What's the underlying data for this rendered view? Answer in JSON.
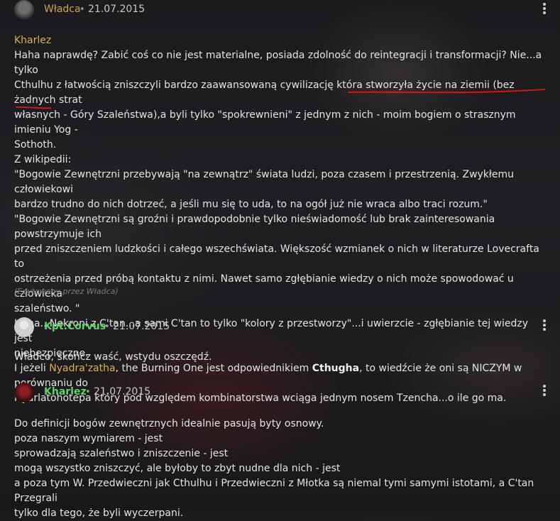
{
  "comments": [
    {
      "author": "Władca",
      "date": "21.07.2015",
      "quote_author": "Kharlez",
      "lines": [
        "Haha naprawdę? Zabić coś co nie jest materialne, posiada zdolność do reintegracji i transformacji? Nie...a tylko",
        "Cthulhu z łatwością zniszczyli bardzo zaawansowaną cywilizację która stworzyła życie na ziemii (bez żadnych strat",
        "własnych - Góry Szaleństwa),a byli tylko \"spokrewnieni\" z jednym z nich - moim bogiem o strasznym imieniu Yog -",
        "Sothoth.",
        "Z wikipedii:",
        "\"Bogowie Zewnętrzni przebywają \"na zewnątrz\" świata ludzi, poza czasem i przestrzenią. Zwykłemu człowiekowi",
        "bardzo trudno do nich dotrzeć, a jeśli mu się to uda, to na ogół już nie wraca albo traci rozum.\"",
        "\"Bogowie Zewnętrzni są groźni i prawdopodobnie tylko nieświadomość lub brak zainteresowania powstrzymuje ich",
        "przed zniszczeniem ludzkości i całego wszechświata. Większość wzmianek o nich w literaturze Lovecrafta to",
        "ostrzeżenia przed próbą kontaktu z nimi. Nawet samo zgłębianie wiedzy o nich może spowodować u człowieka",
        "szaleństwo. \"",
        "Haha...Nekroni z C'tan...a sami C'tan to tylko \"kolory z przestworzy\"...i uwierzcie - zgłębianie tej wiedzy jest",
        "niebezpieczne."
      ],
      "line14_a": "I jeżeli ",
      "line14_link": "Nyadra'zatha",
      "line14_b": ", the Burning One jest odpowiednikiem ",
      "line14_bold": "Cthugha",
      "line14_c": ", to wiedźcie że oni są NICZYM w porównaniu do",
      "line15": "Nyarlatohotepa który pod względem kombinatorstwa wciąga jednym nosem Tzencha...o ile go ma.",
      "edited": "(Edytowany przez Władca)"
    },
    {
      "author": "Kpt.Corvus",
      "date": "21.07.2015",
      "lines": [
        "Władco, skończ waść, wstydu oszczędź."
      ]
    },
    {
      "author": "Kharlez",
      "date": "21.07.2015",
      "lines": [
        "Do definicji bogów zewnętrznych idealnie pasują byty osnowy.",
        "poza naszym wymiarem - jest",
        "sprowadzają szaleństwo i zniszczenie - jest",
        "mogą wszystko zniszczyć, ale byłoby to zbyt nudne dla nich - jest",
        "a poza tym W. Przedwieczni jak Cthulhu i Przedwieczni z Młotka są niemal tymi samymi istotami, a C'tan Przegrali",
        "tylko dla tego, że byli wyczerpani."
      ]
    }
  ],
  "separator": "•",
  "colors": {
    "author_gold": "#c9a64a",
    "author_green": "#5fd36a",
    "link_gold": "#d7b34a",
    "annotation_red": "#d01818"
  },
  "icons": {
    "menu": "kebab-menu-icon"
  }
}
